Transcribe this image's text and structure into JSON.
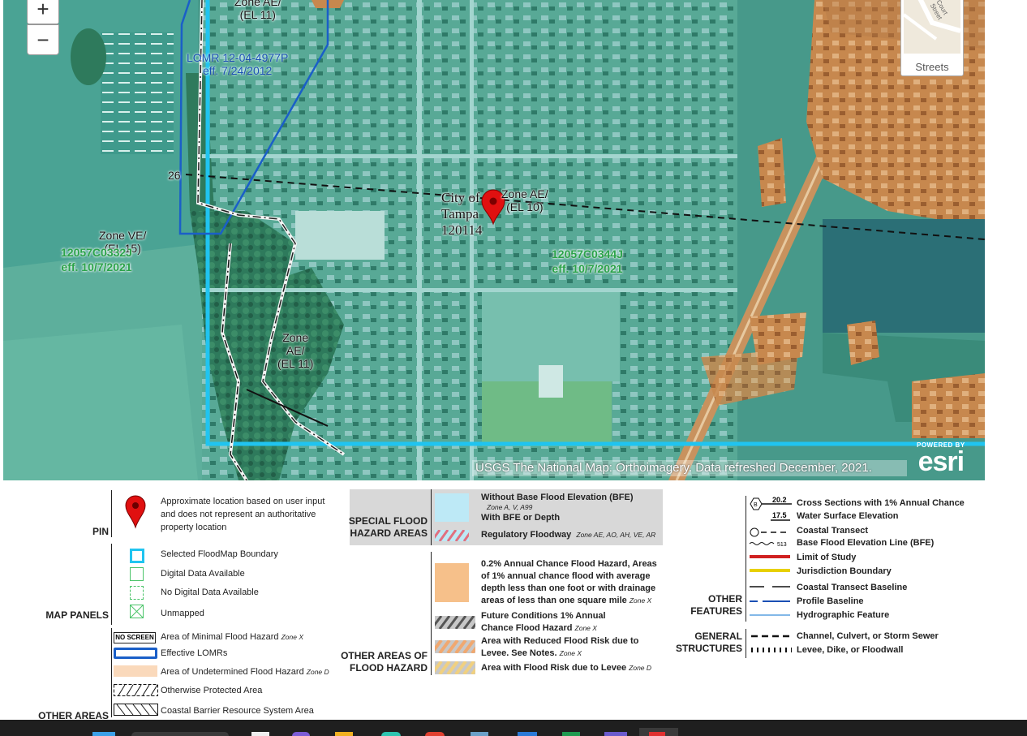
{
  "map": {
    "zoom_in": "+",
    "zoom_out": "−",
    "basemap_label": "Streets",
    "basemap_thumb_text": "Court Street",
    "labels": {
      "zone_ae_11_top": [
        "Zone AE/",
        "(EL 11)"
      ],
      "lomr": [
        "LOMR 12-04-4977P",
        "eff. 7/24/2012"
      ],
      "cross_section": "26",
      "city": [
        "City of",
        "Tampa",
        "120114"
      ],
      "zone_ae_10": [
        "Zone AE/",
        "(EL 10)"
      ],
      "zone_ve_15": [
        "Zone VE/",
        "(EL 15)"
      ],
      "panel_left": [
        "12057C0332J",
        "eff. 10/7/2021"
      ],
      "panel_right": [
        "12057C0344J",
        "eff. 10/7/2021"
      ],
      "zone_ae_11_bottom": [
        "Zone",
        "AE/",
        "(EL 11)"
      ]
    },
    "attribution": "USGS The National Map: Orthoimagery. Data refreshed December, 2021.",
    "esri_powered": "POWERED BY",
    "esri_logo": "esri"
  },
  "legend": {
    "pin": {
      "heading": "PIN",
      "text": [
        "Approximate location based on user input",
        "and does not represent an authoritative",
        "property location"
      ]
    },
    "map_panels": {
      "heading": "MAP PANELS",
      "items": [
        "Selected FloodMap Boundary",
        "Digital Data Available",
        "No Digital Data Available",
        "Unmapped"
      ]
    },
    "other_areas": {
      "heading": "OTHER AREAS",
      "no_screen": "NO SCREEN",
      "items": [
        {
          "label": "Area of Minimal Flood Hazard",
          "zone": "Zone X"
        },
        {
          "label": "Effective LOMRs",
          "zone": ""
        },
        {
          "label": "Area of Undetermined Flood Hazard",
          "zone": "Zone D"
        },
        {
          "label": "Otherwise Protected Area",
          "zone": ""
        },
        {
          "label": "Coastal Barrier Resource System Area",
          "zone": ""
        }
      ]
    },
    "special_flood": {
      "heading": [
        "SPECIAL FLOOD",
        "HAZARD AREAS"
      ],
      "without_bfe": "Without Base Flood Elevation (BFE)",
      "without_bfe_zones": "Zone A, V, A99",
      "with_bfe": "With BFE or Depth",
      "floodway": "Regulatory Floodway",
      "floodway_zones": "Zone AE, AO, AH, VE, AR"
    },
    "other_flood": {
      "heading": [
        "OTHER AREAS OF",
        "FLOOD HAZARD"
      ],
      "annual_02": [
        "0.2% Annual Chance Flood Hazard, Areas",
        "of 1% annual chance flood with average",
        "depth less than one foot or with drainage",
        "areas of less than one square mile"
      ],
      "annual_02_zone": "Zone X",
      "future": [
        "Future Conditions 1% Annual",
        "Chance Flood Hazard"
      ],
      "future_zone": "Zone X",
      "reduced": [
        "Area with Reduced Flood Risk due to",
        "Levee. See Notes."
      ],
      "reduced_zone": "Zone X",
      "levee_risk": "Area with Flood Risk due to Levee",
      "levee_risk_zone": "Zone D"
    },
    "other_features": {
      "heading": [
        "OTHER",
        "FEATURES"
      ],
      "cross_section_value": "20.2",
      "wse_value": "17.5",
      "bfe_value": "513",
      "items": [
        "Cross Sections with 1% Annual Chance",
        "Water Surface Elevation",
        "Coastal Transect",
        "Base Flood Elevation Line (BFE)",
        "Limit of Study",
        "Jurisdiction Boundary",
        "Coastal Transect Baseline",
        "Profile Baseline",
        "Hydrographic Feature"
      ]
    },
    "general_structures": {
      "heading": [
        "GENERAL",
        "STRUCTURES"
      ],
      "items": [
        "Channel, Culvert, or Storm Sewer",
        "Levee, Dike, or Floodwall"
      ]
    }
  },
  "colors": {
    "floodmap_boundary": "#20c4f0",
    "lomr_blue": "#1a4fb4",
    "zone_x_orange": "#f6c08a",
    "floodway_red": "#e05050",
    "limit_of_study": "#d02020",
    "jurisdiction": "#e8d000",
    "profile_baseline": "#1a4fb4",
    "hydro": "#5aa0e0",
    "pin_red": "#e01010"
  }
}
